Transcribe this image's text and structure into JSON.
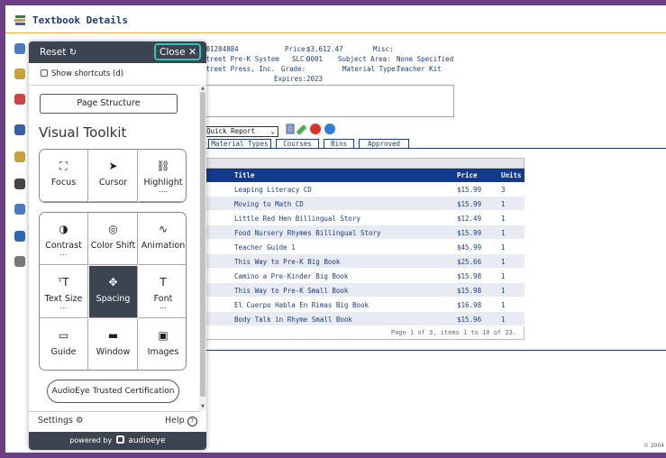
{
  "window": {
    "title": "Textbook Details"
  },
  "record": {
    "isbn": "501284884",
    "publisher_line1": "Street Pre-K System",
    "publisher_line2": "Street Press, Inc.",
    "price_label": "Price:",
    "price_value": "$3,612.47",
    "slc_label": "SLC:",
    "slc_value": "0001",
    "grade_label": "Grade:",
    "grade_value": "",
    "expires_label": "Expires:",
    "expires_value": "2023",
    "misc_label": "Misc:",
    "misc_value": "",
    "subject_label": "Subject Area:",
    "subject_value": "None Specified",
    "mtype_label": "Material Type:",
    "mtype_value": "Teacher Kit"
  },
  "report": {
    "selected": "Quick Report"
  },
  "tabs": [
    "Material Types",
    "Courses",
    "Bins",
    "Approved"
  ],
  "grid": {
    "columns": {
      "title": "Title",
      "price": "Price",
      "units": "Units"
    },
    "rows": [
      {
        "title": "Leaping Literacy CD",
        "price": "$15.99",
        "units": "3"
      },
      {
        "title": "Moving to Math CD",
        "price": "$15.99",
        "units": "1"
      },
      {
        "title": "Little Red Hen Billingual Story",
        "price": "$12.49",
        "units": "1"
      },
      {
        "title": "Food Nursery Rhymes Billingual Story",
        "price": "$15.99",
        "units": "1"
      },
      {
        "title": "Teacher Guide 1",
        "price": "$45.99",
        "units": "1"
      },
      {
        "title": "This Way to Pre-K Big Book",
        "price": "$25.66",
        "units": "1"
      },
      {
        "title": "Camino a Pre-Kinder Big Book",
        "price": "$15.98",
        "units": "1"
      },
      {
        "title": "This Way to Pre-K Small Book",
        "price": "$15.98",
        "units": "1"
      },
      {
        "title": "El Cuerpo Habla En Rimas Big Book",
        "price": "$16.98",
        "units": "1"
      },
      {
        "title": "Body Talk in Rhyme Small Book",
        "price": "$15.96",
        "units": "1"
      }
    ],
    "pager": "Page 1 of 3, items 1 to 10 of 23."
  },
  "copyright": "© 2004",
  "toolkit": {
    "reset_label": "Reset",
    "close_label": "Close",
    "shortcuts_label": "Show shortcuts (d)",
    "page_structure_label": "Page Structure",
    "title": "Visual Toolkit",
    "group1": [
      {
        "label": "Focus",
        "icon": "focus-icon",
        "dots": ""
      },
      {
        "label": "Cursor",
        "icon": "cursor-icon",
        "dots": ""
      },
      {
        "label": "Highlight",
        "icon": "link-icon",
        "dots": "...."
      }
    ],
    "group2": [
      {
        "label": "Contrast",
        "icon": "contrast-icon",
        "dots": "..."
      },
      {
        "label": "Color Shift",
        "icon": "color-shift-icon",
        "dots": ""
      },
      {
        "label": "Animation",
        "icon": "animation-icon",
        "dots": ""
      },
      {
        "label": "Text Size",
        "icon": "text-size-icon",
        "dots": "..."
      },
      {
        "label": "Spacing",
        "icon": "spacing-icon",
        "dots": ""
      },
      {
        "label": "Font",
        "icon": "font-icon",
        "dots": "..."
      },
      {
        "label": "Guide",
        "icon": "guide-icon",
        "dots": ""
      },
      {
        "label": "Window",
        "icon": "window-icon",
        "dots": ""
      },
      {
        "label": "Images",
        "icon": "images-icon",
        "dots": ""
      }
    ],
    "cert_label": "AudioEye Trusted Certification",
    "settings_label": "Settings",
    "help_label": "Help",
    "footer_powered": "powered by",
    "footer_brand": "audioeye",
    "accent_color": "#2ec4b6",
    "dark_color": "#3b4450"
  }
}
